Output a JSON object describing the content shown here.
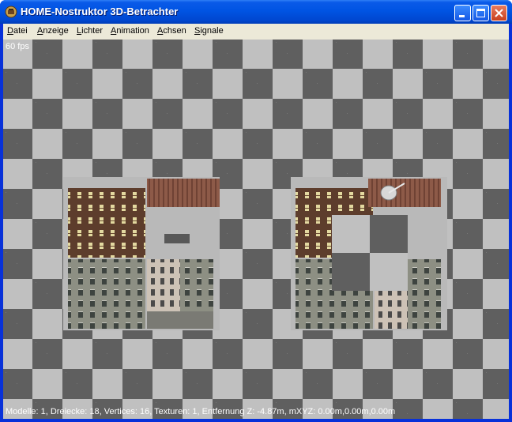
{
  "window": {
    "title": "HOME-Nostruktor 3D-Betrachter",
    "icon": "app-icon",
    "controls": [
      "minimize-icon",
      "maximize-icon",
      "close-icon"
    ]
  },
  "menu": {
    "items": [
      {
        "label": "Datei",
        "accel": "D",
        "rest": "atei"
      },
      {
        "label": "Anzeige",
        "accel": "A",
        "rest": "nzeige"
      },
      {
        "label": "Lichter",
        "accel": "L",
        "rest": "ichter"
      },
      {
        "label": "Animation",
        "accel": "A",
        "rest": "nimation"
      },
      {
        "label": "Achsen",
        "accel": "A",
        "rest": "chsen"
      },
      {
        "label": "Signale",
        "accel": "S",
        "rest": "ignale"
      }
    ]
  },
  "viewport": {
    "fps": "60 fps",
    "status": "Modelle: 1, Dreiecke: 18, Vertices: 16, Texturen: 1, Entfernung Z: -4.87m, mXYZ: 0.00m,0.00m,0.00m",
    "background": "checkerboard",
    "colors": {
      "dark": "#5f5f5f",
      "light": "#c0c0c0"
    }
  }
}
